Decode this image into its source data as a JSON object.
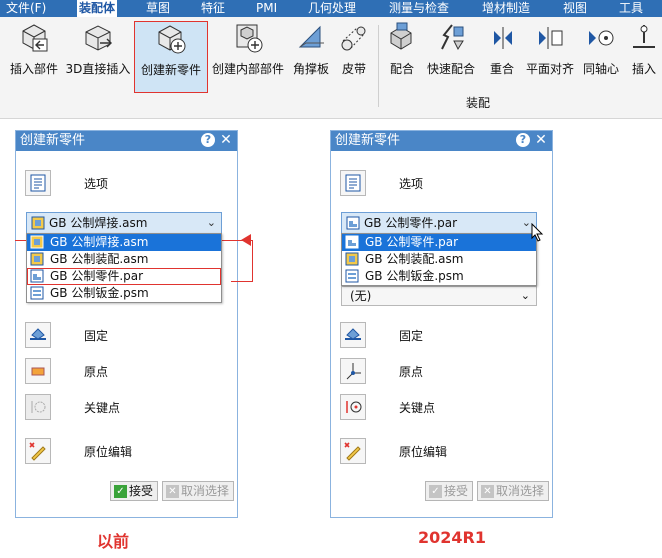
{
  "menu": {
    "items": [
      "文件(F)",
      "装配体",
      "草图",
      "特征",
      "PMI",
      "几何处理",
      "测量与检查",
      "增材制造",
      "视图",
      "工具"
    ],
    "active_index": 1
  },
  "ribbon": {
    "buttons": [
      "插入部件",
      "3D直接插入",
      "创建新零件",
      "创建内部部件",
      "角撑板",
      "皮带",
      "配合",
      "快速配合",
      "重合",
      "平面对齐",
      "同轴心",
      "插入"
    ],
    "highlighted": "创建新零件",
    "group_label": "装配"
  },
  "dialog_before": {
    "title": "创建新零件",
    "options_label": "选项",
    "combo_value": "GB 公制焊接.asm",
    "list": [
      "GB 公制焊接.asm",
      "GB 公制装配.asm",
      "GB 公制零件.par",
      "GB 公制钣金.psm"
    ],
    "rows": [
      "固定",
      "原点",
      "关键点",
      "原位编辑"
    ],
    "accept": "接受",
    "cancel_select": "取消选择"
  },
  "dialog_after": {
    "title": "创建新零件",
    "options_label": "选项",
    "combo_value": "GB 公制零件.par",
    "list": [
      "GB 公制零件.par",
      "GB 公制装配.asm",
      "GB 公制钣金.psm"
    ],
    "second_combo": "(无)",
    "rows": [
      "固定",
      "原点",
      "关键点",
      "原位编辑"
    ],
    "accept": "接受",
    "cancel_select": "取消选择"
  },
  "captions": {
    "before": "以前",
    "after": "2024R1"
  },
  "colors": {
    "accent": "#2f6fb5",
    "highlight_border": "#e0342f",
    "selection": "#1a73d9"
  }
}
